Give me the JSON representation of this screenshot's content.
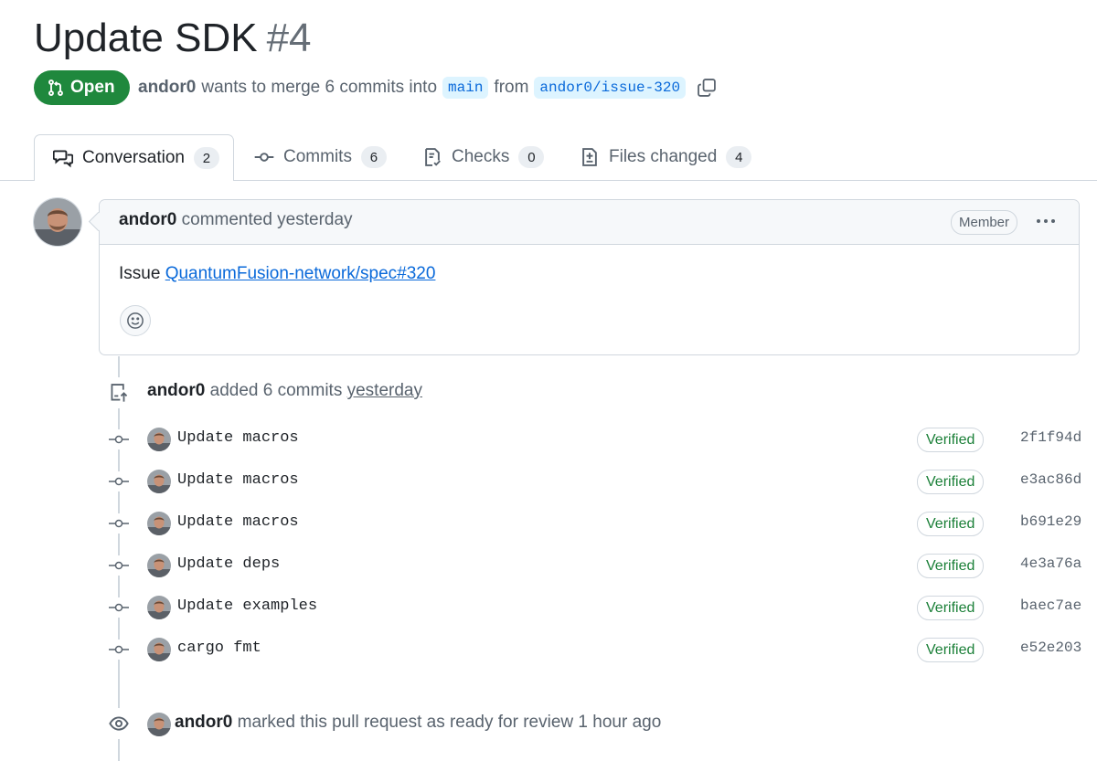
{
  "pr": {
    "title": "Update SDK",
    "number": "#4",
    "state": "Open",
    "author": "andor0",
    "merge_text": "wants to merge 6 commits into",
    "base_branch": "main",
    "from_text": "from",
    "head_branch": "andor0/issue-320"
  },
  "tabs": [
    {
      "label": "Conversation",
      "count": "2",
      "icon": "comment-discussion-icon"
    },
    {
      "label": "Commits",
      "count": "6",
      "icon": "git-commit-icon"
    },
    {
      "label": "Checks",
      "count": "0",
      "icon": "checklist-icon"
    },
    {
      "label": "Files changed",
      "count": "4",
      "icon": "file-diff-icon"
    }
  ],
  "comment": {
    "author": "andor0",
    "action": "commented yesterday",
    "role": "Member",
    "body_prefix": "Issue",
    "body_link": "QuantumFusion-network/spec#320"
  },
  "commits_event": {
    "author": "andor0",
    "text": "added 6 commits",
    "time": "yesterday"
  },
  "commits": [
    {
      "message": "Update macros",
      "status": "Verified",
      "sha": "2f1f94d"
    },
    {
      "message": "Update macros",
      "status": "Verified",
      "sha": "e3ac86d"
    },
    {
      "message": "Update macros",
      "status": "Verified",
      "sha": "b691e29"
    },
    {
      "message": "Update deps",
      "status": "Verified",
      "sha": "4e3a76a"
    },
    {
      "message": "Update examples",
      "status": "Verified",
      "sha": "baec7ae"
    },
    {
      "message": "cargo fmt",
      "status": "Verified",
      "sha": "e52e203"
    }
  ],
  "ready_event": {
    "author": "andor0",
    "text": "marked this pull request as ready for review 1 hour ago"
  },
  "colors": {
    "open_green": "#1f883d",
    "link_blue": "#0969da",
    "verified_green": "#1a7f37"
  }
}
